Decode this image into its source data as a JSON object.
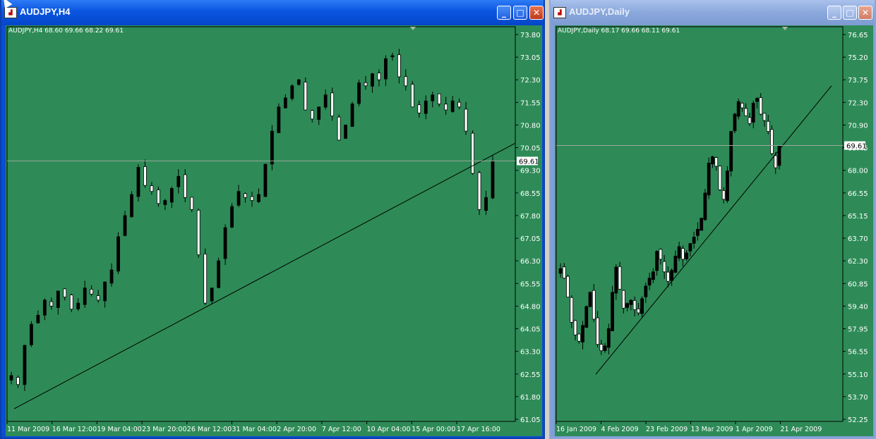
{
  "windows": [
    {
      "id": "h4",
      "title": "AUDJPY,H4",
      "info": "AUDJPY,H4  68.60 69.66 68.22 69.61",
      "buttons": {
        "minimize": "_",
        "maximize": "□",
        "close": "✕"
      },
      "chart_data": {
        "type": "candlestick",
        "symbol": "AUDJPY",
        "timeframe": "H4",
        "ohlc": {
          "open": 68.6,
          "high": 69.66,
          "low": 68.22,
          "close": 69.61
        },
        "current_price_label": "69.61",
        "y_ticks": [
          "73.80",
          "73.05",
          "72.30",
          "71.55",
          "70.80",
          "70.05",
          "69.30",
          "68.55",
          "67.80",
          "67.05",
          "66.30",
          "65.55",
          "64.80",
          "64.05",
          "63.30",
          "62.55",
          "61.80",
          "61.05"
        ],
        "ylim": [
          61.05,
          73.8
        ],
        "x_ticks": [
          "11 Mar 2009",
          "16 Mar 12:00",
          "19 Mar 04:00",
          "23 Mar 20:00",
          "26 Mar 12:00",
          "31 Mar 04:00",
          "2 Apr 20:00",
          "7 Apr 12:00",
          "10 Apr 04:00",
          "15 Apr 00:00",
          "17 Apr 16:00"
        ],
        "price_path": [
          62.5,
          62.2,
          63.5,
          64.2,
          64.5,
          65.0,
          64.8,
          65.3,
          65.1,
          64.7,
          64.9,
          65.4,
          65.2,
          65.0,
          65.6,
          66.0,
          67.1,
          67.8,
          68.5,
          69.4,
          68.8,
          68.6,
          68.2,
          68.3,
          68.7,
          69.1,
          68.4,
          68.0,
          66.5,
          64.9,
          65.4,
          66.3,
          67.4,
          68.1,
          68.6,
          68.4,
          68.3,
          68.5,
          69.5,
          70.6,
          71.4,
          71.7,
          72.1,
          72.3,
          71.3,
          71.0,
          71.4,
          71.8,
          71.1,
          70.3,
          70.8,
          71.5,
          72.2,
          72.1,
          72.5,
          72.3,
          73.0,
          73.1,
          72.4,
          72.1,
          71.4,
          71.2,
          71.6,
          71.8,
          71.5,
          71.3,
          71.6,
          71.4,
          70.6,
          69.2,
          68.0,
          68.4,
          69.6
        ],
        "trendline": {
          "x": [
            "11 Mar 2009",
            "17 Apr 16:00"
          ],
          "y": [
            61.4,
            70.2
          ]
        }
      }
    },
    {
      "id": "d1",
      "title": "AUDJPY,Daily",
      "info": "AUDJPY,Daily  68.17 69.66 68.11 69.61",
      "buttons": {
        "minimize": "_",
        "maximize": "□",
        "close": "✕"
      },
      "chart_data": {
        "type": "candlestick",
        "symbol": "AUDJPY",
        "timeframe": "Daily",
        "ohlc": {
          "open": 68.17,
          "high": 69.66,
          "low": 68.11,
          "close": 69.61
        },
        "current_price_label": "69.61",
        "y_ticks": [
          "76.65",
          "75.20",
          "73.75",
          "72.30",
          "70.90",
          "69.45",
          "68.00",
          "66.55",
          "65.15",
          "63.70",
          "62.30",
          "60.85",
          "59.40",
          "57.95",
          "56.55",
          "55.10",
          "53.70",
          "52.25"
        ],
        "ylim": [
          52.25,
          76.65
        ],
        "x_ticks": [
          "16 Jan 2009",
          "4 Feb 2009",
          "23 Feb 2009",
          "13 Mar 2009",
          "1 Apr 2009",
          "21 Apr 2009"
        ],
        "price_path": [
          61.8,
          61.2,
          60.0,
          58.4,
          57.6,
          57.2,
          58.2,
          59.4,
          60.3,
          58.6,
          57.0,
          56.6,
          56.9,
          58.0,
          60.3,
          61.9,
          60.5,
          59.3,
          59.6,
          59.8,
          59.2,
          59.0,
          59.9,
          60.7,
          61.2,
          61.6,
          62.9,
          62.4,
          61.6,
          61.0,
          61.7,
          62.6,
          63.2,
          62.4,
          62.8,
          63.4,
          63.8,
          64.3,
          65.0,
          66.6,
          68.5,
          68.9,
          68.3,
          66.8,
          66.2,
          68.0,
          70.5,
          71.6,
          72.4,
          72.0,
          71.5,
          71.0,
          72.3,
          72.6,
          71.6,
          71.2,
          70.5,
          69.1,
          68.2,
          69.6
        ],
        "trendline": {
          "x": [
            "4 Feb 2009",
            "21 Apr 2009"
          ],
          "y": [
            55.1,
            73.4
          ]
        }
      }
    }
  ]
}
